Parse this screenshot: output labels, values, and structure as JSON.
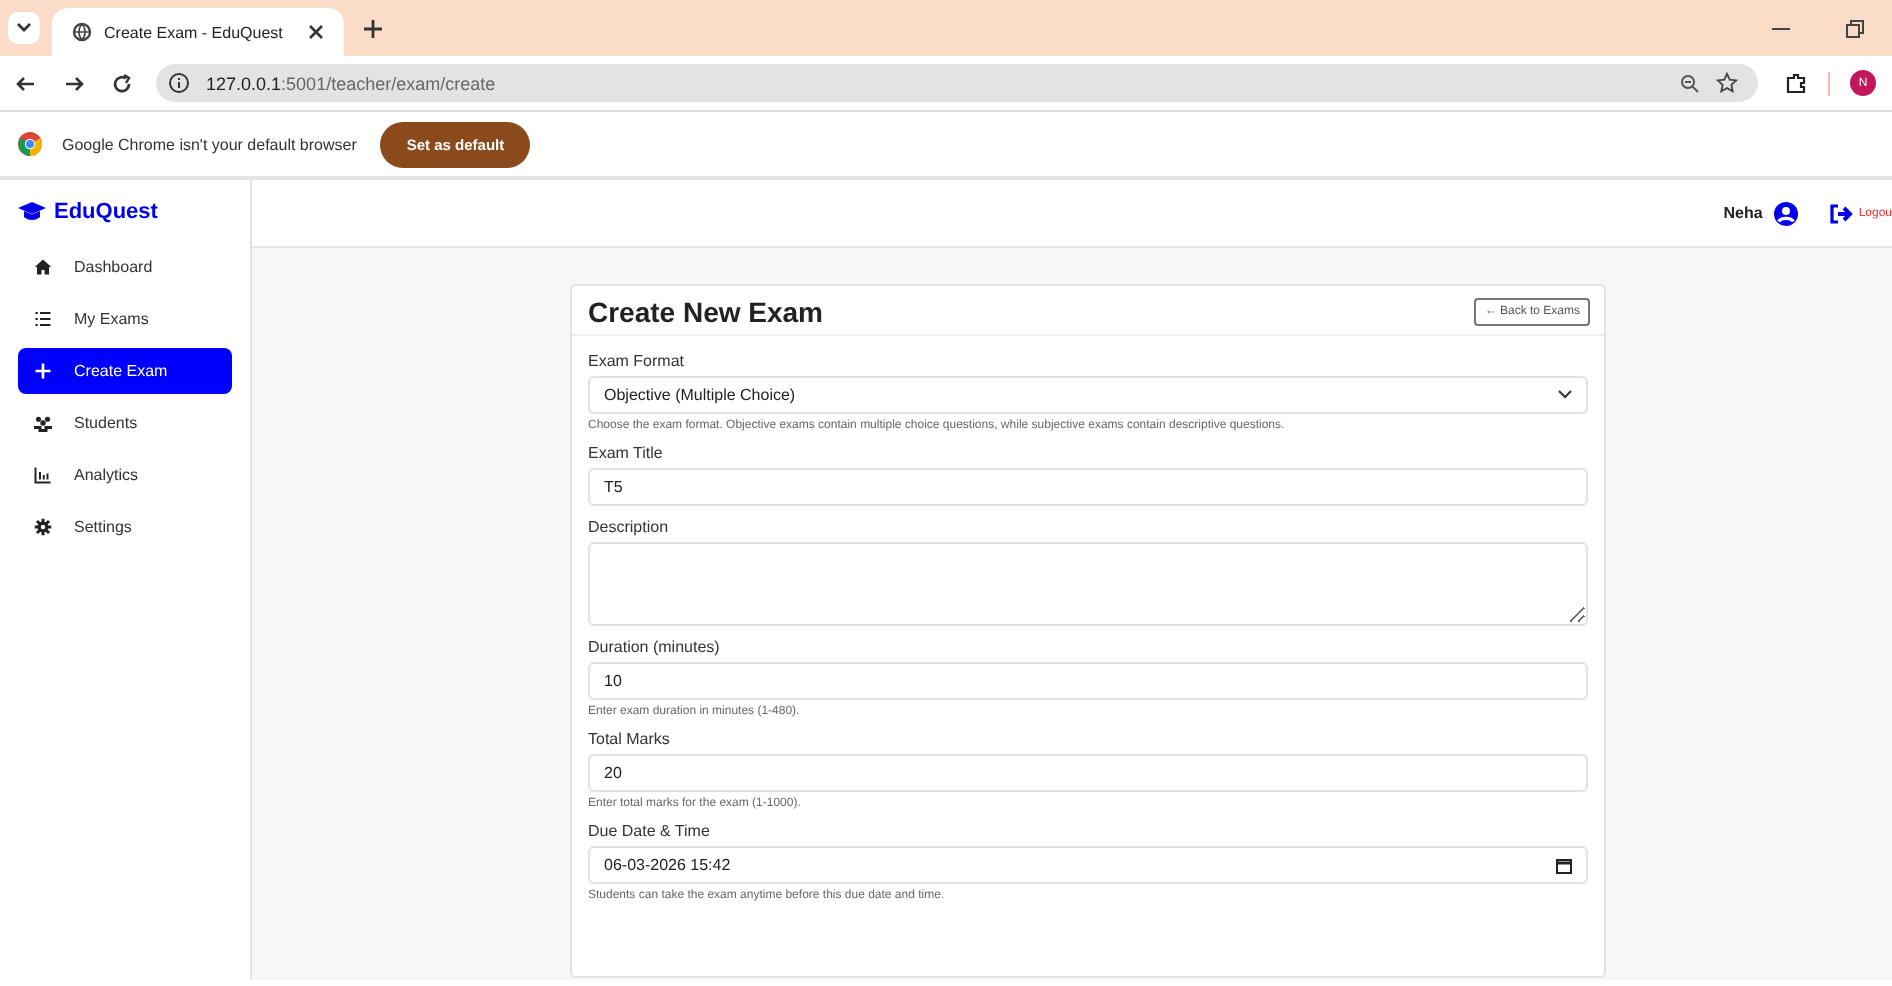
{
  "browser": {
    "tab_title": "Create Exam - EduQuest",
    "url_host": "127.0.0.1",
    "url_path": ":5001/teacher/exam/create",
    "profile_initial": "N",
    "infobar": {
      "message": "Google Chrome isn't your default browser",
      "button": "Set as default"
    }
  },
  "sidebar": {
    "brand": "EduQuest",
    "items": [
      {
        "label": "Dashboard",
        "kind": "home",
        "selected": false
      },
      {
        "label": "My Exams",
        "kind": "list",
        "selected": false
      },
      {
        "label": "Create Exam",
        "kind": "plus",
        "selected": true
      },
      {
        "label": "Students",
        "kind": "users",
        "selected": false
      },
      {
        "label": "Analytics",
        "kind": "chart",
        "selected": false
      },
      {
        "label": "Settings",
        "kind": "gear",
        "selected": false
      }
    ]
  },
  "header": {
    "user": "Neha",
    "logout": "Logou"
  },
  "form": {
    "title": "Create New Exam",
    "back_button": "← Back to Exams",
    "fields": [
      {
        "kind": "select",
        "label": "Exam Format",
        "value": "Objective (Multiple Choice)",
        "help": "Choose the exam format. Objective exams contain multiple choice questions, while subjective exams contain descriptive questions."
      },
      {
        "kind": "text",
        "label": "Exam Title",
        "value": "T5"
      },
      {
        "kind": "textarea",
        "label": "Description"
      },
      {
        "kind": "text",
        "label": "Duration (minutes)",
        "value": "10",
        "help": "Enter exam duration in minutes (1-480)."
      },
      {
        "kind": "text",
        "label": "Total Marks",
        "value": "20",
        "help": "Enter total marks for the exam (1-1000)."
      },
      {
        "kind": "datetime",
        "label": "Due Date & Time",
        "value": "06-03-2026 15:42",
        "help": "Students can take the exam anytime before this due date and time."
      }
    ]
  }
}
